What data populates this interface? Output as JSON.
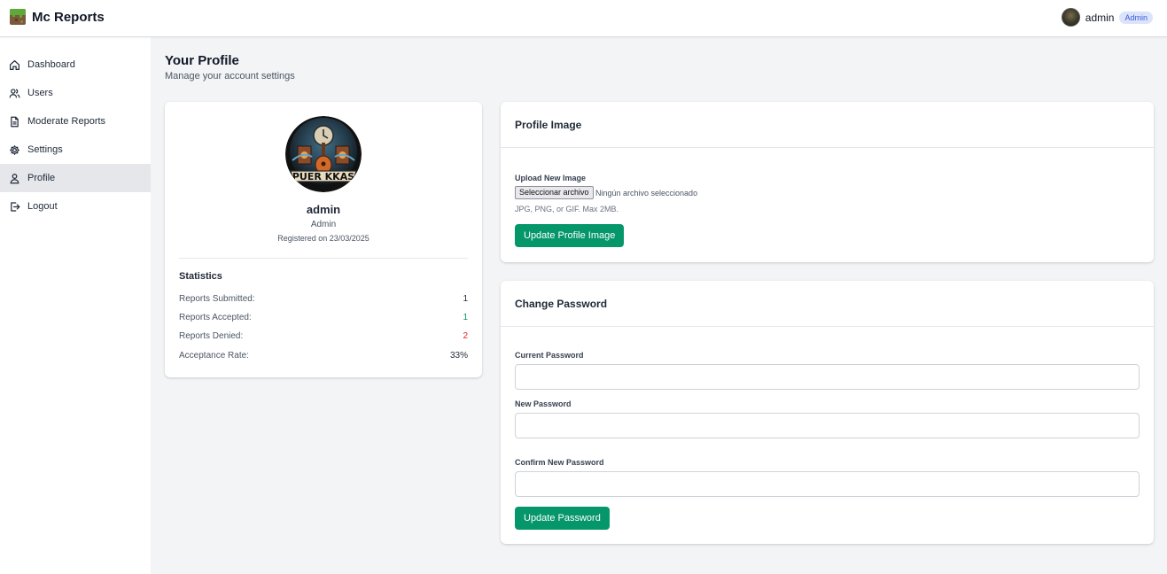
{
  "header": {
    "brand": "Mc Reports",
    "user": {
      "name": "admin",
      "role_badge": "Admin"
    }
  },
  "sidebar": {
    "items": [
      {
        "label": "Dashboard",
        "icon": "home-icon",
        "active": false
      },
      {
        "label": "Users",
        "icon": "users-icon",
        "active": false
      },
      {
        "label": "Moderate Reports",
        "icon": "document-icon",
        "active": false
      },
      {
        "label": "Settings",
        "icon": "gear-icon",
        "active": false
      },
      {
        "label": "Profile",
        "icon": "user-icon",
        "active": true
      },
      {
        "label": "Logout",
        "icon": "logout-icon",
        "active": false
      }
    ]
  },
  "page": {
    "title": "Your Profile",
    "subtitle": "Manage your account settings"
  },
  "profile": {
    "name": "admin",
    "role": "Admin",
    "registered": "Registered on 23/03/2025",
    "avatar_text": "PUER KKAS"
  },
  "statistics": {
    "title": "Statistics",
    "rows": [
      {
        "label": "Reports Submitted:",
        "value": "1",
        "color": "#1f2937"
      },
      {
        "label": "Reports Accepted:",
        "value": "1",
        "color": "#059669"
      },
      {
        "label": "Reports Denied:",
        "value": "2",
        "color": "#dc2626"
      },
      {
        "label": "Acceptance Rate:",
        "value": "33%",
        "color": "#1f2937"
      }
    ]
  },
  "profile_image": {
    "title": "Profile Image",
    "upload_label": "Upload New Image",
    "file_button": "Seleccionar archivo",
    "file_status": "Ningún archivo seleccionado",
    "hint": "JPG, PNG, or GIF. Max 2MB.",
    "submit": "Update Profile Image"
  },
  "change_password": {
    "title": "Change Password",
    "current_label": "Current Password",
    "current_value": "",
    "new_label": "New Password",
    "new_value": "",
    "confirm_label": "Confirm New Password",
    "confirm_value": "",
    "submit": "Update Password"
  },
  "colors": {
    "accent_green": "#059669",
    "badge_blue": "#3b5bd6",
    "active_nav_bg": "#e5e7eb"
  }
}
